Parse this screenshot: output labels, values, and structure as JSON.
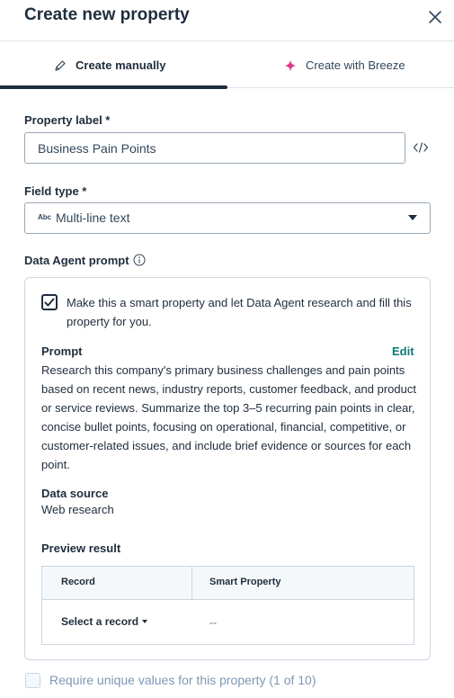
{
  "header": {
    "title": "Create new property",
    "close_icon": "close-icon"
  },
  "tabs": [
    {
      "label": "Create manually",
      "icon": "pencil-icon",
      "active": true
    },
    {
      "label": "Create with Breeze",
      "icon": "sparkle-icon",
      "active": false,
      "icon_color": "#e0358c"
    }
  ],
  "property_label": {
    "label": "Property label *",
    "value": "Business Pain Points",
    "code_icon": "code-icon"
  },
  "field_type": {
    "label": "Field type *",
    "prefix": "Abc",
    "value": "Multi-line text"
  },
  "data_agent": {
    "label": "Data Agent prompt",
    "info_icon": "info-icon",
    "smart_checkbox_checked": true,
    "smart_text": "Make this a smart property and let Data Agent research and fill this property for you.",
    "prompt_label": "Prompt",
    "edit_label": "Edit",
    "prompt_text": "Research this company's primary business challenges and pain points based on recent news, industry reports, customer feedback, and product or service reviews. Summarize the top 3–5 recurring pain points in clear, concise bullet points, focusing on operational, financial, competitive, or customer-related issues, and include brief evidence or sources for each point.",
    "data_source_label": "Data source",
    "data_source_value": "Web research",
    "preview_label": "Preview result",
    "table": {
      "headers": [
        "Record",
        "Smart Property"
      ],
      "record_select": "Select a record",
      "value": "--"
    }
  },
  "unique": {
    "checked": false,
    "label": "Require unique values for this property (1 of 10)"
  },
  "colors": {
    "accent_text": "#0b7a75",
    "text_dark": "#1f2d3d",
    "border": "#cbd6e2",
    "sparkle": "#e0358c"
  }
}
